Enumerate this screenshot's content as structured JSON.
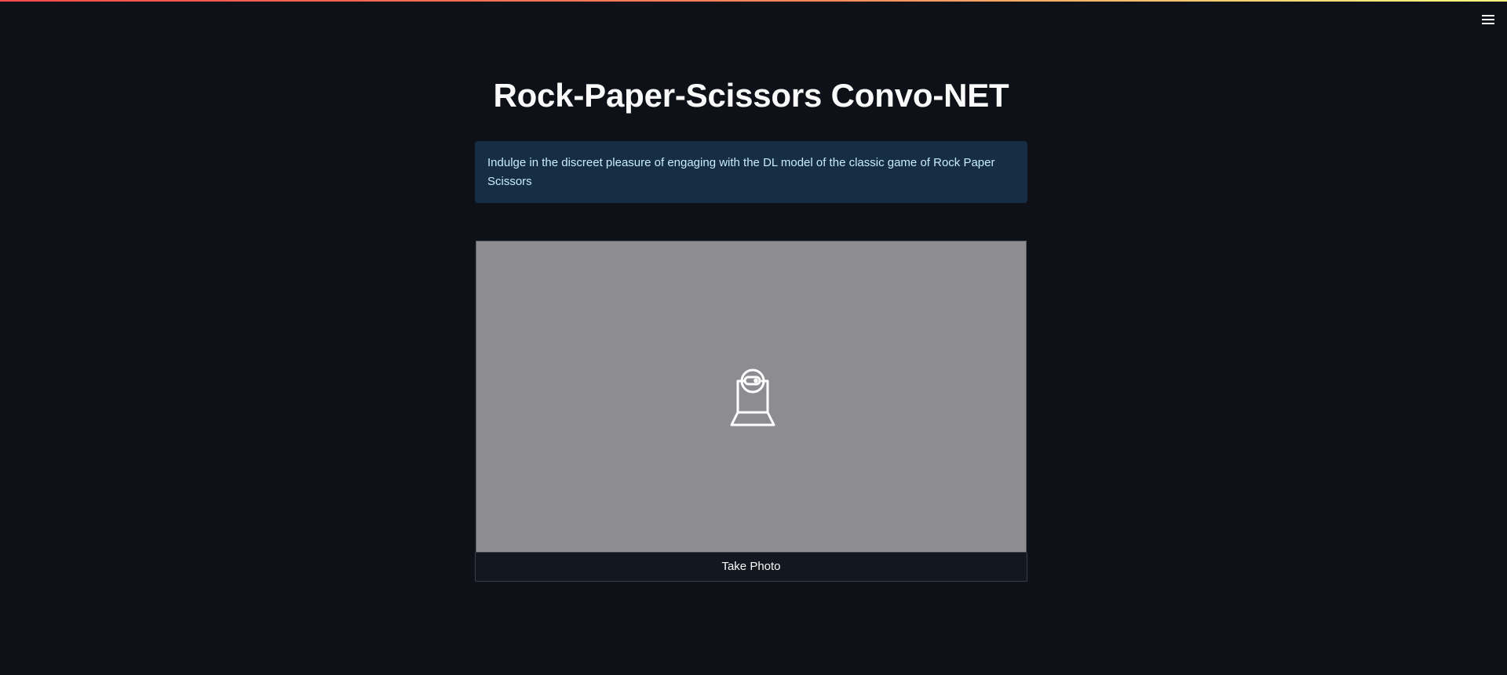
{
  "app": {
    "title": "Rock-Paper-Scissors Convo-NET",
    "info_text": "Indulge in the discreet pleasure of engaging with the DL model of the classic game of Rock Paper Scissors"
  },
  "camera": {
    "icon": "webcam-icon",
    "button_label": "Take Photo"
  },
  "header": {
    "menu_icon": "hamburger-menu-icon"
  },
  "colors": {
    "background": "#0e1117",
    "info_background": "#172d43",
    "info_text": "#c7ebff",
    "camera_placeholder": "#8d8c91",
    "accent_gradient_start": "#ff4b4b",
    "accent_gradient_end": "#fffd80"
  }
}
